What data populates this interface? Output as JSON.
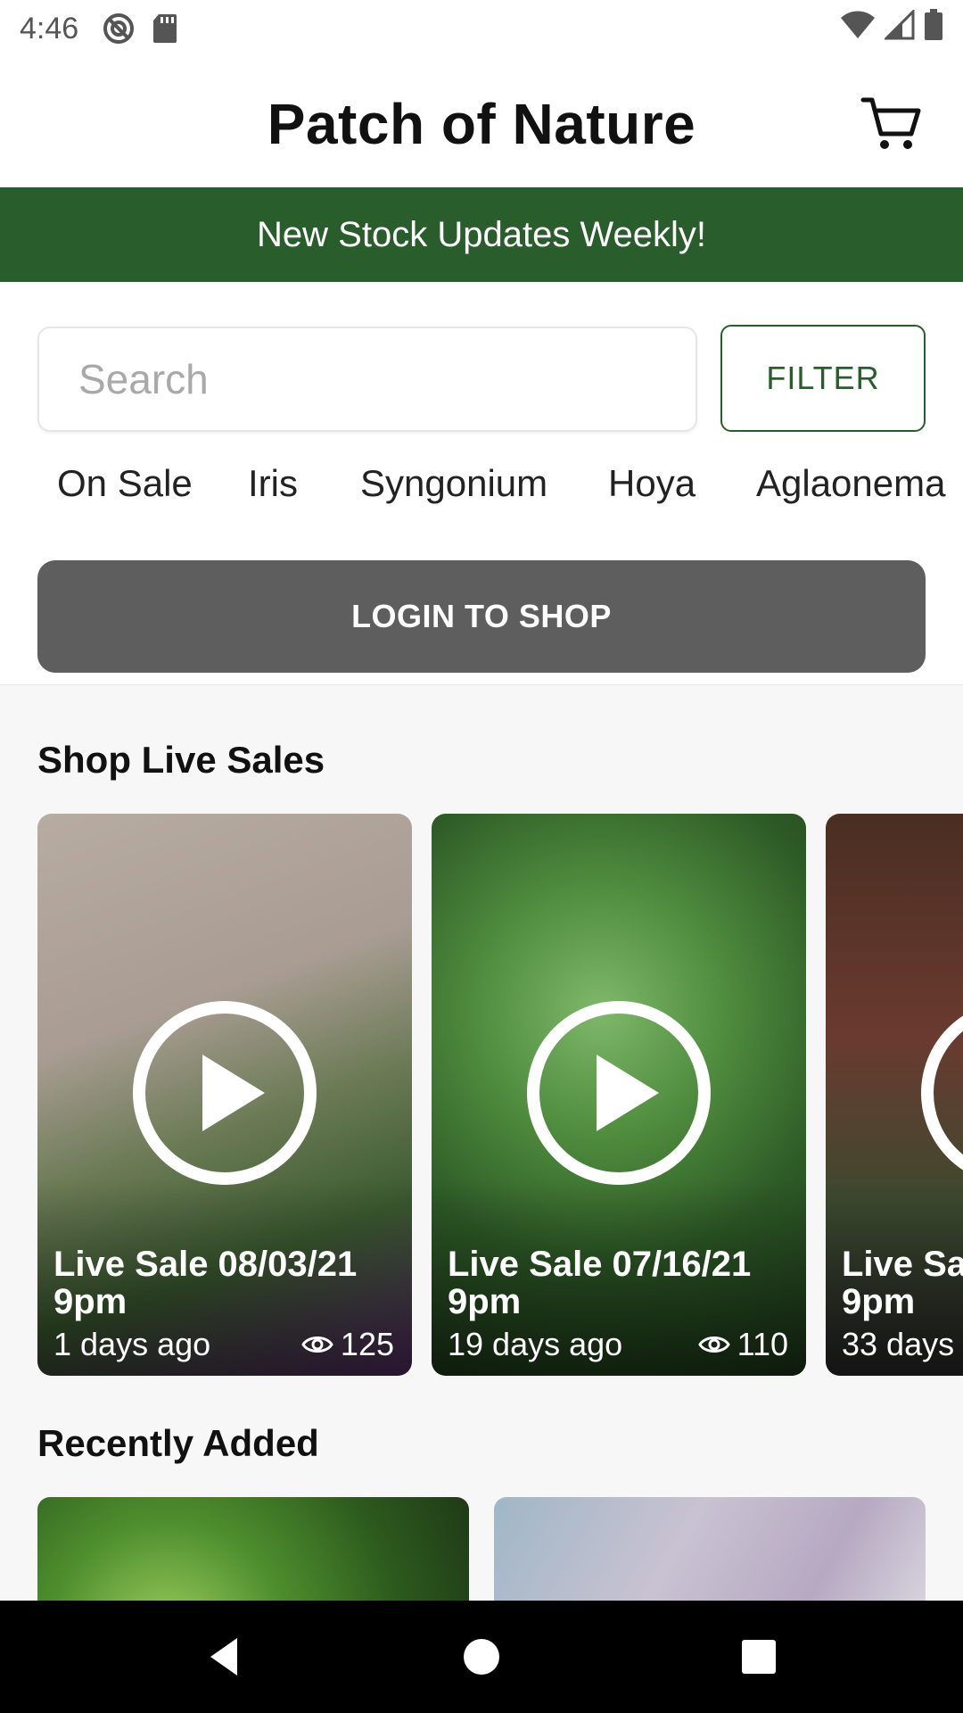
{
  "status_bar": {
    "time": "4:46",
    "left_icons": [
      "do-not-disturb-icon",
      "sd-card-icon"
    ],
    "right_icons": [
      "wifi-icon",
      "cell-signal-icon",
      "battery-icon"
    ]
  },
  "app_bar": {
    "title": "Patch of Nature",
    "cart_icon": "cart-icon"
  },
  "banner": {
    "text": "New Stock Updates Weekly!",
    "color": "#2a5d2c"
  },
  "search": {
    "placeholder": "Search",
    "value": ""
  },
  "filter_button": {
    "label": "FILTER"
  },
  "categories": [
    "On Sale",
    "Iris",
    "Syngonium",
    "Hoya",
    "Aglaonema"
  ],
  "login_button": {
    "label": "LOGIN TO SHOP"
  },
  "live_sales": {
    "title": "Shop Live Sales",
    "items": [
      {
        "title": "Live Sale 08/03/21 9pm",
        "ago": "1 days ago",
        "views": "125"
      },
      {
        "title": "Live Sale 07/16/21 9pm",
        "ago": "19 days ago",
        "views": "110"
      },
      {
        "title": "Live Sa",
        "title_line2": "9pm",
        "ago": "33 days",
        "views": ""
      }
    ]
  },
  "recently_added": {
    "title": "Recently Added"
  },
  "nav_bar": {
    "icons": [
      "back-icon",
      "home-icon",
      "recents-icon"
    ]
  }
}
